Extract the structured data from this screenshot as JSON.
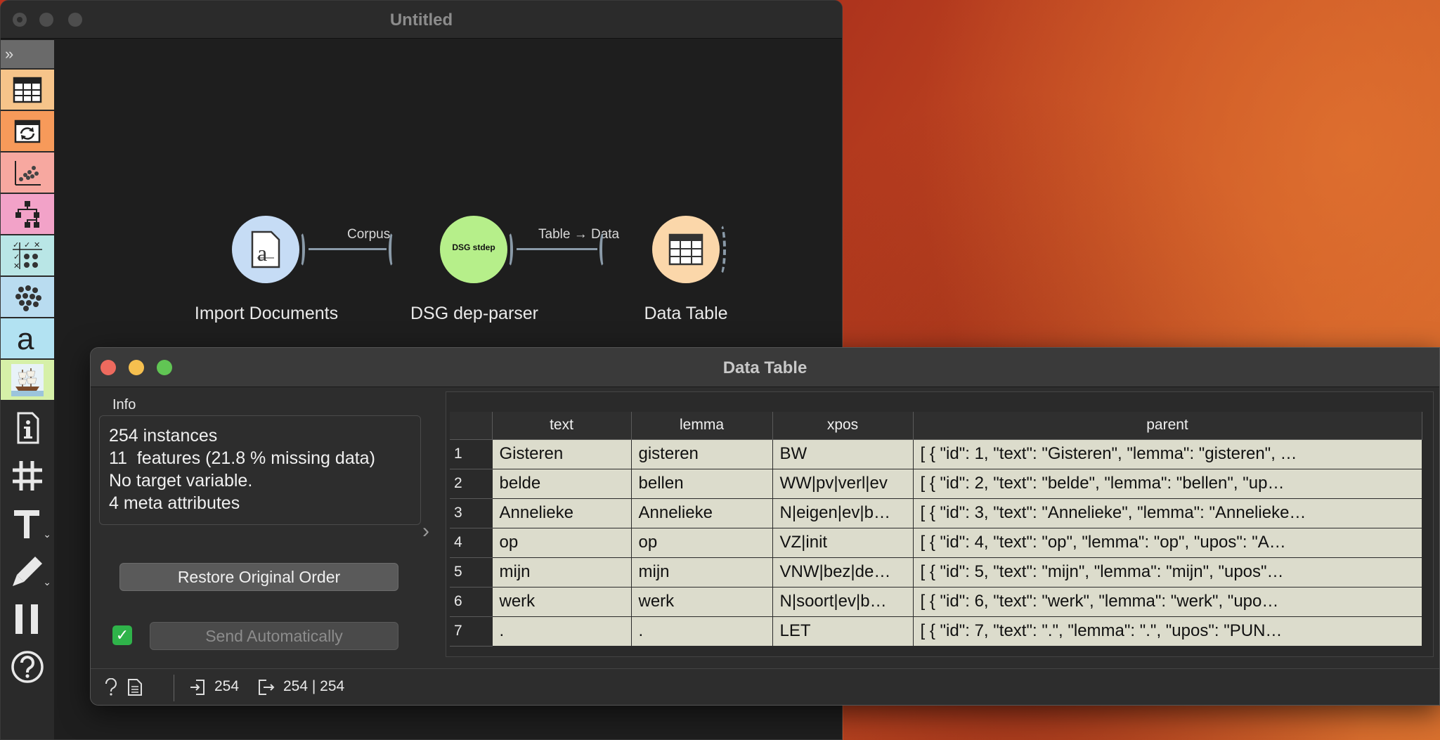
{
  "main_window": {
    "title": "Untitled"
  },
  "toolbox": {
    "expander": "»",
    "categories": [
      {
        "name": "data",
        "color": "#f6c48a",
        "icon": "table-grid-icon"
      },
      {
        "name": "transform",
        "color": "#f79a5a",
        "icon": "transform-icon"
      },
      {
        "name": "visualize",
        "color": "#f7a8a0",
        "icon": "scatter-plot-icon"
      },
      {
        "name": "model",
        "color": "#f2a2c8",
        "icon": "tree-icon"
      },
      {
        "name": "evaluate",
        "color": "#b9e6e6",
        "icon": "evaluate-icon"
      },
      {
        "name": "unsupervised",
        "color": "#b9dcf0",
        "icon": "cluster-icon"
      },
      {
        "name": "text-mining",
        "color": "#b2e2f2",
        "icon": "text-a-icon"
      },
      {
        "name": "custom",
        "color": "#d6f0a8",
        "icon": "ship-icon"
      }
    ],
    "tools": [
      "info-icon",
      "grid-icon",
      "text-tool-icon",
      "pen-icon",
      "pause-icon",
      "help-icon"
    ]
  },
  "canvas": {
    "nodes": [
      {
        "label": "Import Documents",
        "icon": "document-a-icon"
      },
      {
        "label": "DSG dep-parser",
        "icon_text": "DSG stdep"
      },
      {
        "label": "Data Table",
        "icon": "table-grid-icon"
      }
    ],
    "links": [
      {
        "label": "Corpus"
      },
      {
        "label": "Table → Data"
      }
    ]
  },
  "data_table_window": {
    "title": "Data Table",
    "info_label": "Info",
    "info_lines": [
      "254 instances",
      "11  features (21.8 % missing data)",
      "No target variable.",
      "4 meta attributes"
    ],
    "restore_button": "Restore Original Order",
    "send_auto_checked": true,
    "send_button": "Send Automatically",
    "table": {
      "columns": [
        "text",
        "lemma",
        "xpos",
        "parent"
      ],
      "rows": [
        {
          "idx": "1",
          "text": "Gisteren",
          "lemma": "gisteren",
          "xpos": "BW",
          "parent": "[  {    \"id\": 1,   \"text\": \"Gisteren\",   \"lemma\": \"gisteren\",  …"
        },
        {
          "idx": "2",
          "text": "belde",
          "lemma": "bellen",
          "xpos": "WW|pv|verl|ev",
          "parent": "[  {    \"id\": 2,   \"text\": \"belde\",   \"lemma\": \"bellen\",   \"up…"
        },
        {
          "idx": "3",
          "text": "Annelieke",
          "lemma": "Annelieke",
          "xpos": "N|eigen|ev|b…",
          "parent": "[  {    \"id\": 3,   \"text\": \"Annelieke\",   \"lemma\": \"Annelieke…"
        },
        {
          "idx": "4",
          "text": "op",
          "lemma": "op",
          "xpos": "VZ|init",
          "parent": "[  {    \"id\": 4,   \"text\": \"op\",   \"lemma\": \"op\",   \"upos\": \"A…"
        },
        {
          "idx": "5",
          "text": "mijn",
          "lemma": "mijn",
          "xpos": "VNW|bez|de…",
          "parent": "[  {    \"id\": 5,   \"text\": \"mijn\",   \"lemma\": \"mijn\",   \"upos\"…"
        },
        {
          "idx": "6",
          "text": "werk",
          "lemma": "werk",
          "xpos": "N|soort|ev|b…",
          "parent": "[  {    \"id\": 6,   \"text\": \"werk\",   \"lemma\": \"werk\",   \"upo…"
        },
        {
          "idx": "7",
          "text": ".",
          "lemma": ".",
          "xpos": "LET",
          "parent": "[  {    \"id\": 7,   \"text\": \".\",   \"lemma\": \".\",   \"upos\": \"PUN…"
        }
      ]
    },
    "status": {
      "input_count": "254",
      "output_count": "254 | 254"
    }
  }
}
